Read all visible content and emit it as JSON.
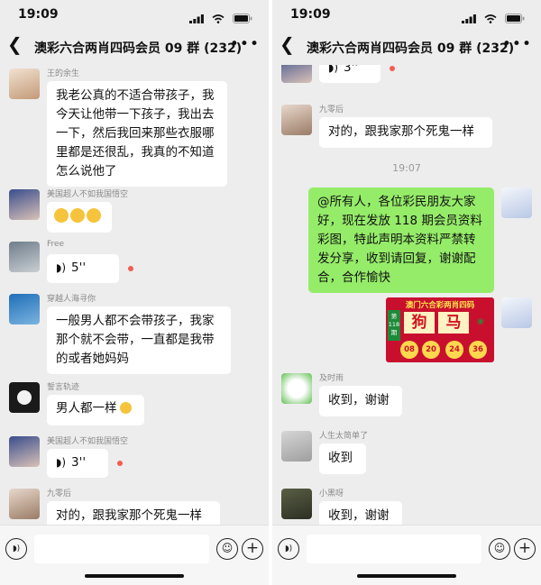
{
  "status": {
    "time": "19:09"
  },
  "group": {
    "title": "澳彩六合两肖四码会员 09 群 (232)"
  },
  "left": {
    "messages": [
      {
        "sender": "王的余生",
        "lines": [
          "我老公真的不适合带孩子，我",
          "今天让他带一下孩子，我出去",
          "一下，然后我回来那些衣服哪",
          "里都是还很乱，我真的不知道",
          "怎么说他了"
        ]
      },
      {
        "sender": "美国超人不如我国悟空"
      },
      {
        "sender": "Free",
        "voice": "5''"
      },
      {
        "sender": "穿越人海寻你",
        "lines": [
          "一般男人都不会带孩子，我家",
          "那个就不会带，一直都是我带",
          "的或者她妈妈"
        ]
      },
      {
        "sender": "誓言轨迹",
        "lines": [
          "男人都一样"
        ]
      },
      {
        "sender": "美国超人不如我国悟空",
        "voice": "3''"
      },
      {
        "sender": "九零后",
        "lines": [
          "对的，跟我家那个死鬼一样"
        ]
      }
    ]
  },
  "right": {
    "messages": [
      {
        "voice": "3''"
      },
      {
        "sender": "九零后",
        "lines": [
          "对的，跟我家那个死鬼一样"
        ]
      },
      {
        "time": "19:07"
      },
      {
        "lines": [
          "@所有人，各位彩民朋友大家",
          "好，现在发放 118 期会员资料",
          "彩图，特此声明本资料严禁转",
          "发分享，收到请回复，谢谢配",
          "合，合作愉快"
        ]
      },
      {
        "poster": {
          "header": "澳门六合彩两肖四码",
          "issue_label": "第",
          "issue": "118",
          "issue_suffix": "期",
          "zodiac": [
            "狗",
            "马"
          ],
          "numbers": [
            "08",
            "20",
            "24",
            "36"
          ]
        }
      },
      {
        "sender": "及时雨",
        "lines": [
          "收到，谢谢"
        ]
      },
      {
        "sender": "人生太简单了",
        "lines": [
          "收到"
        ]
      },
      {
        "sender": "小黑呀",
        "lines": [
          "收到，谢谢"
        ]
      }
    ]
  },
  "icons": {
    "voice": "sound-wave-icon",
    "emoji": "smiley-icon",
    "plus": "plus-icon",
    "back": "chevron-left-icon",
    "more": "ellipsis-icon"
  },
  "colors": {
    "background": "#ededed",
    "bubble_self": "#95ec69",
    "bubble_other": "#ffffff",
    "unread_dot": "#f55c4f"
  }
}
